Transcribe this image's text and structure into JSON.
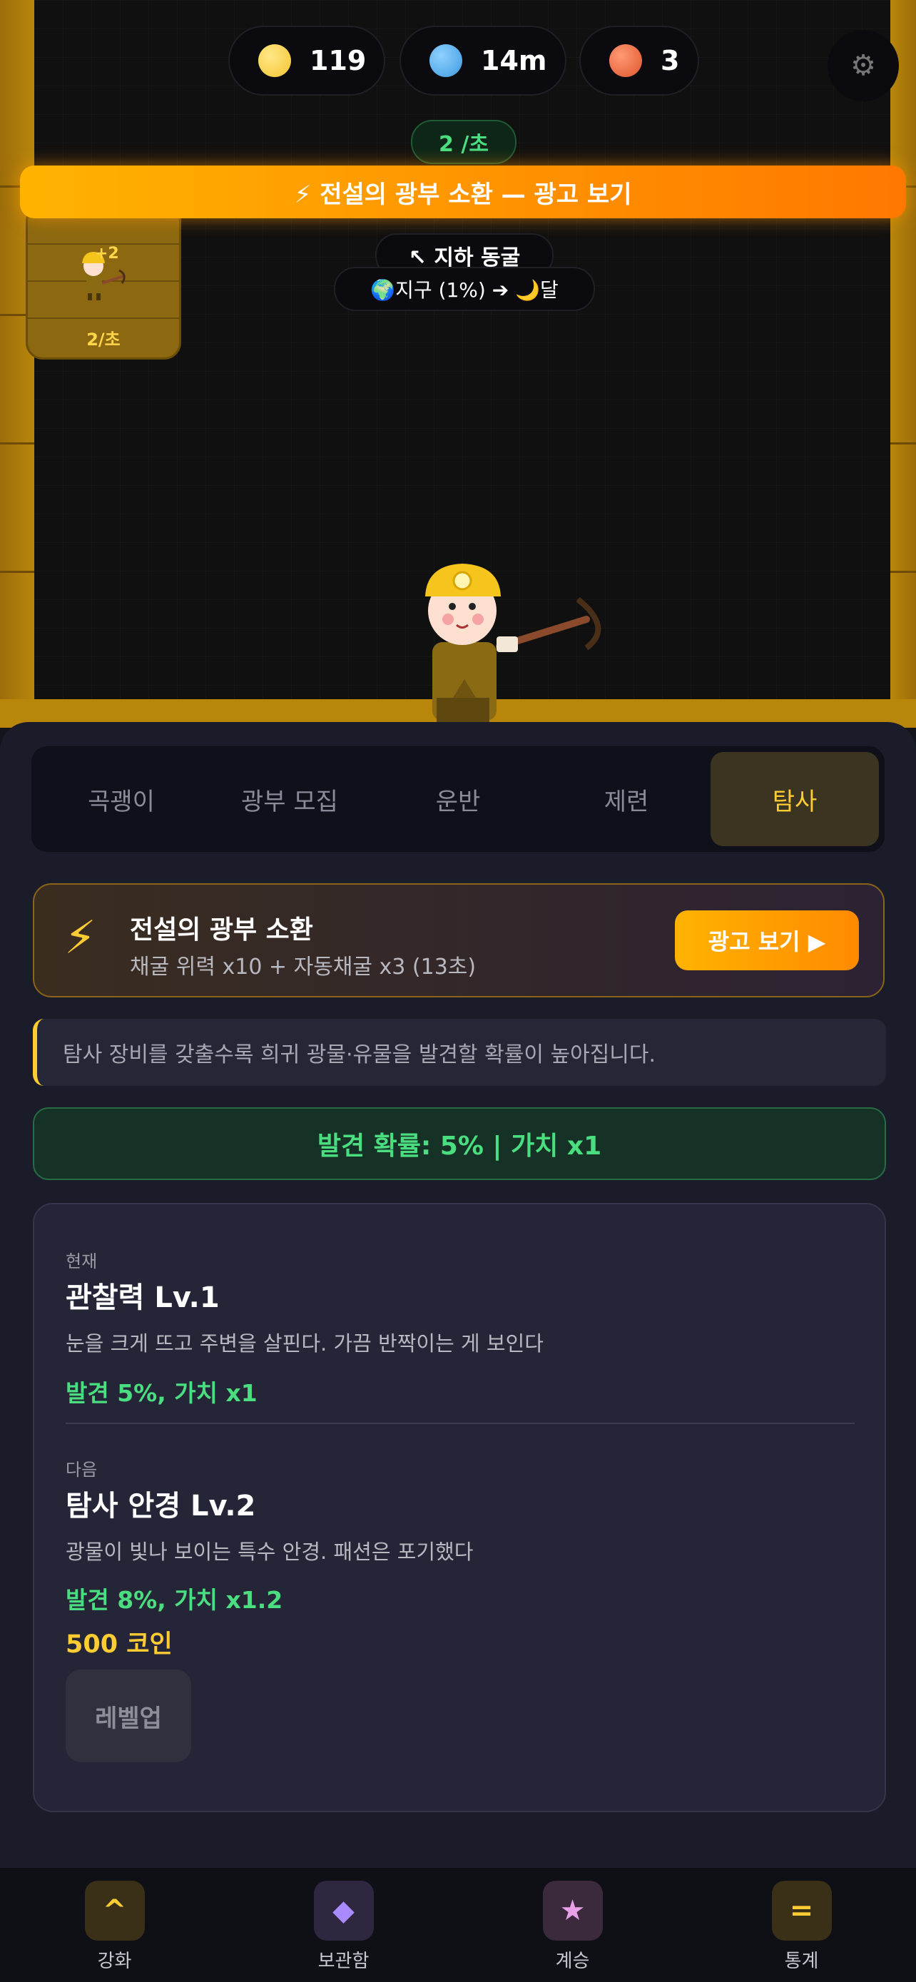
{
  "resources": [
    {
      "icon": "gold-coin-icon",
      "value": "119",
      "color": "#f6c532"
    },
    {
      "icon": "blue-gem-icon",
      "value": "14m",
      "color": "#3d9be0"
    },
    {
      "icon": "red-orb-icon",
      "value": "3",
      "color": "#e0552c"
    }
  ],
  "settings_icon": "⚙",
  "rate": "2 /초",
  "ad_banner": "⚡ 전설의 광부 소환 — 광고 보기",
  "miner_card": {
    "plus": "+2",
    "rate": "2/초"
  },
  "location": "↖ 지하 동굴",
  "route": "🌍지구 (1%) ➔ 🌙달",
  "tabs": [
    {
      "label": "곡괭이"
    },
    {
      "label": "광부 모집"
    },
    {
      "label": "운반"
    },
    {
      "label": "제련"
    },
    {
      "label": "탐사",
      "active": true
    }
  ],
  "summon_card": {
    "icon": "⚡",
    "title": "전설의 광부 소환",
    "subtitle": "채굴 위력 x10 + 자동채굴 x3 (13초)",
    "button": "광고 보기 ▶"
  },
  "notice": "탐사 장비를 갖출수록 희귀 광물·유물을 발견할 확률이 높아집니다.",
  "chance": "발견 확률: 5% | 가치 x1",
  "current": {
    "label": "현재",
    "name": "관찰력 Lv.1",
    "desc": "눈을 크게 뜨고 주변을 살핀다. 가끔 반짝이는 게 보인다",
    "effect": "발견 5%, 가치 x1"
  },
  "next": {
    "label": "다음",
    "name": "탐사 안경 Lv.2",
    "desc": "광물이 빛나 보이는 특수 안경. 패션은 포기했다",
    "effect": "발견 8%, 가치 x1.2",
    "cost": "500 코인"
  },
  "levelup_button": "레벨업",
  "bottom_nav": [
    {
      "icon": "^",
      "label": "강화",
      "color": "#ffcc33",
      "bg": "#3a3018"
    },
    {
      "icon": "◆",
      "label": "보관함",
      "color": "#a98aff",
      "bg": "#2f2640"
    },
    {
      "icon": "★",
      "label": "계승",
      "color": "#e8a0e8",
      "bg": "#3a2a3c"
    },
    {
      "icon": "=",
      "label": "통계",
      "color": "#ffcc33",
      "bg": "#3a3018"
    }
  ]
}
